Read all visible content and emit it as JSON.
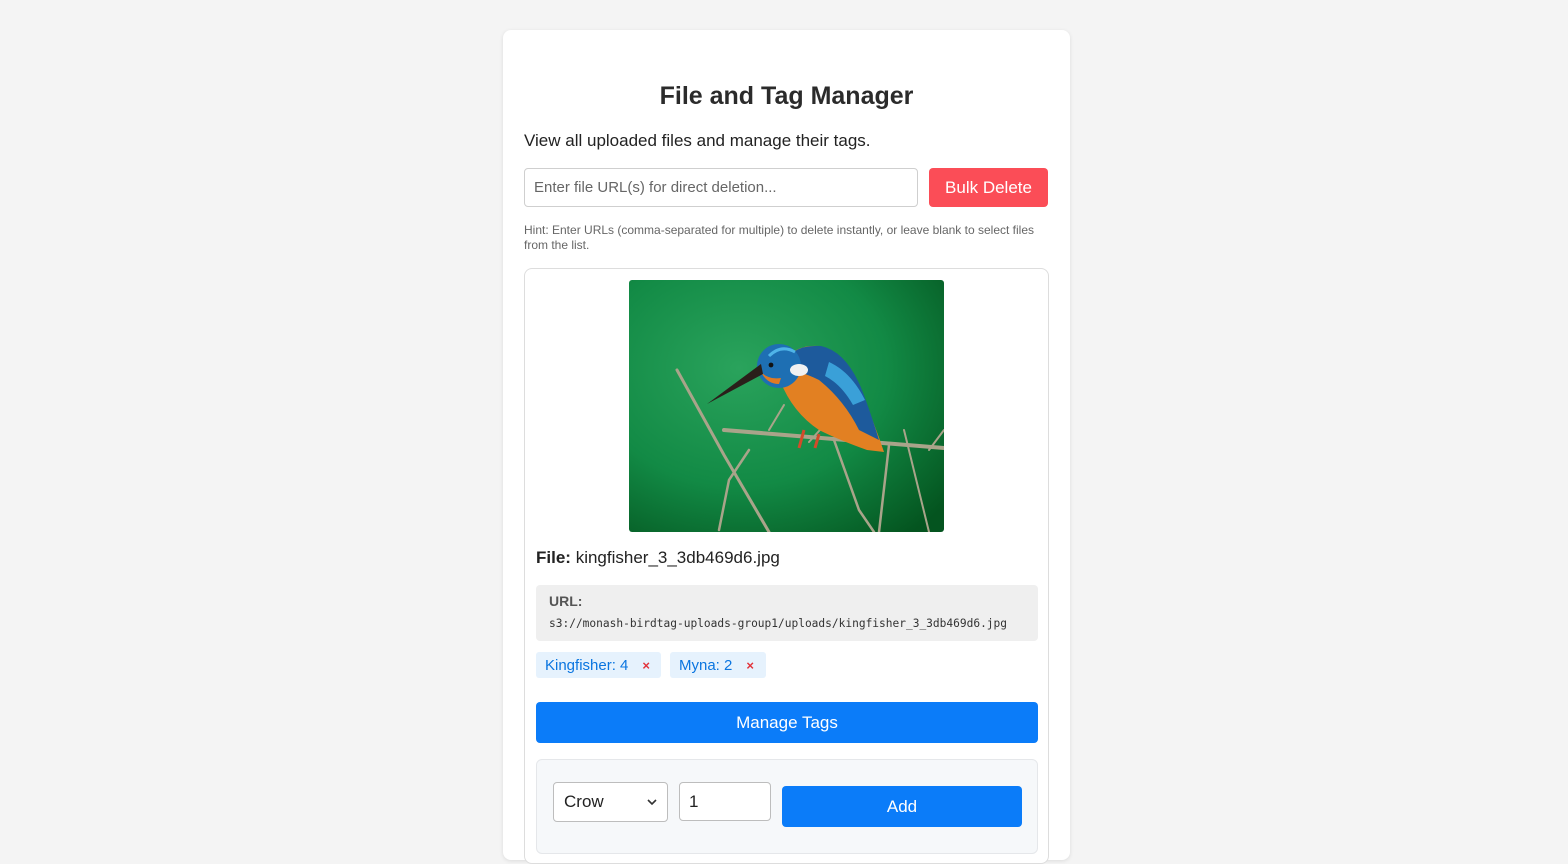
{
  "page": {
    "title": "File and Tag Manager",
    "subtitle": "View all uploaded files and manage their tags."
  },
  "bulk_delete": {
    "placeholder": "Enter file URL(s) for direct deletion...",
    "button_label": "Bulk Delete",
    "hint": "Hint: Enter URLs (comma-separated for multiple) to delete instantly, or leave blank to select files from the list."
  },
  "file": {
    "label": "File:",
    "name": "kingfisher_3_3db469d6.jpg",
    "url_label": "URL:",
    "url": "s3://monash-birdtag-uploads-group1/uploads/kingfisher_3_3db469d6.jpg",
    "tags": [
      {
        "label": "Kingfisher: 4",
        "remove": "×"
      },
      {
        "label": "Myna: 2",
        "remove": "×"
      }
    ],
    "manage_button": "Manage Tags"
  },
  "add_tag": {
    "species": "Crow",
    "count": "1",
    "add_button": "Add"
  },
  "colors": {
    "danger": "#fb4d57",
    "primary": "#0b7cf9",
    "tag_bg": "#e6f2fd",
    "tag_text": "#0a75e0"
  },
  "icons": {
    "select_chevron": "chevron-down-icon",
    "tag_remove": "close-icon"
  }
}
